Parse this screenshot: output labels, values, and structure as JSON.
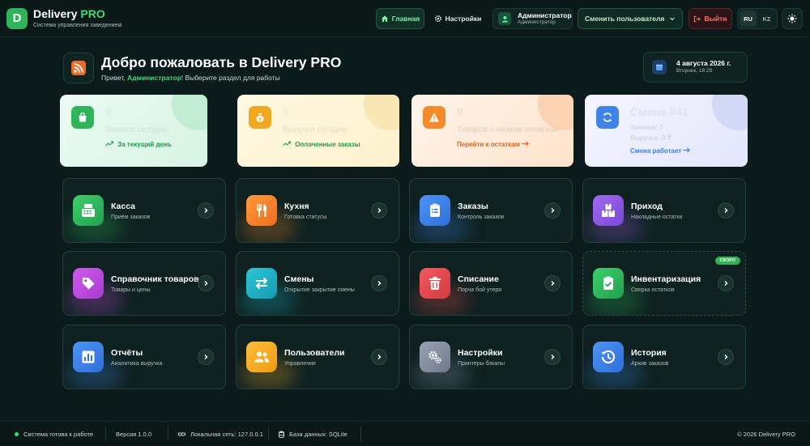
{
  "header": {
    "logo_letter": "D",
    "brand_main": "Delivery ",
    "brand_pro": "PRO",
    "brand_subtitle": "Система управления заведением",
    "home_label": "Главная",
    "settings_label": "Настройки",
    "user_name": "Администратор",
    "user_role": "Администратор",
    "switch_user_label": "Сменить пользователя",
    "logout_label": "Выйти",
    "lang_ru": "RU",
    "lang_kz": "KZ"
  },
  "welcome": {
    "title": "Добро пожаловать в Delivery PRO",
    "greeting_prefix": "Привет, ",
    "greeting_user": "Администратор",
    "greeting_suffix": "! Выберите раздел для работы"
  },
  "date": {
    "main": "4 августа 2026 г.",
    "sub": "Вторник, 18:29"
  },
  "stats": {
    "orders_today": {
      "value": "0",
      "label": "Заказов сегодня",
      "link": "За текущий день"
    },
    "revenue_today": {
      "value": "0",
      "label": "Выручка сегодня",
      "link": "Оплаченные заказы"
    },
    "low_stock": {
      "value": "0",
      "label": "Товаров с низким остатком",
      "link": "Перейти к остаткам"
    },
    "shift": {
      "value": "Смена #41",
      "orders_line": "Заказов: 0",
      "revenue_line": "Выручка: 0 ₸",
      "link": "Смена работает"
    }
  },
  "modules": [
    {
      "title": "Касса",
      "subtitle": "Приём заказов"
    },
    {
      "title": "Кухня",
      "subtitle": "Готовка статусы"
    },
    {
      "title": "Заказы",
      "subtitle": "Контроль заказов"
    },
    {
      "title": "Приход",
      "subtitle": "Накладные остатки"
    },
    {
      "title": "Справочник товаров",
      "subtitle": "Товары и цены"
    },
    {
      "title": "Смены",
      "subtitle": "Открытие закрытие смены"
    },
    {
      "title": "Списание",
      "subtitle": "Порча бой утеря"
    },
    {
      "title": "Инвентаризация",
      "subtitle": "Сверка остатков",
      "badge": "СКОРО"
    },
    {
      "title": "Отчёты",
      "subtitle": "Аналитика выручка"
    },
    {
      "title": "Пользователи",
      "subtitle": "Управление"
    },
    {
      "title": "Настройки",
      "subtitle": "Принтеры бэкапы"
    },
    {
      "title": "История",
      "subtitle": "Архив заказов"
    }
  ],
  "footer": {
    "status": "Система готова к работе",
    "version": "Версия 1.0.0",
    "network": "Локальная сеть: 127.0.0.1",
    "database": "База данных: SQLite",
    "copyright": "© 2026 Delivery PRO"
  },
  "colors": {
    "accent_green": "#2fb45a",
    "background": "#0b1a1a",
    "danger": "#ff6b6b"
  }
}
